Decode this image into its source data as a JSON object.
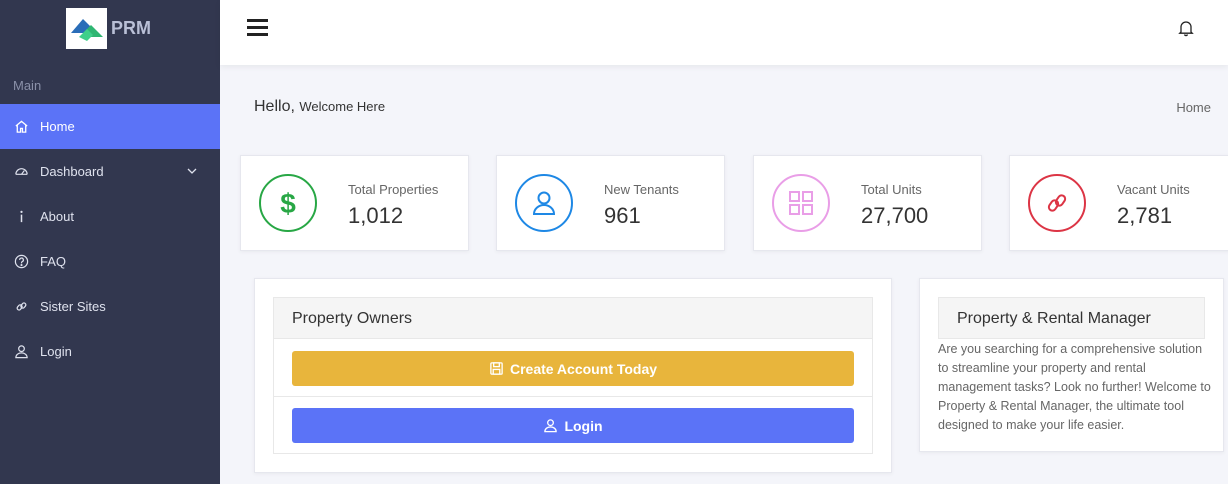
{
  "brand": {
    "name": "PRM"
  },
  "sidebar": {
    "section_label": "Main",
    "items": [
      {
        "label": "Home",
        "icon": "home-icon",
        "active": true
      },
      {
        "label": "Dashboard",
        "icon": "dashboard-icon",
        "has_submenu": true
      },
      {
        "label": "About",
        "icon": "info-icon"
      },
      {
        "label": "FAQ",
        "icon": "help-icon"
      },
      {
        "label": "Sister Sites",
        "icon": "link-icon"
      },
      {
        "label": "Login",
        "icon": "user-icon"
      }
    ]
  },
  "header": {
    "menu_icon": "hamburger-icon",
    "notification_icon": "bell-icon"
  },
  "welcome": {
    "hello": "Hello,",
    "subtitle": "Welcome Here"
  },
  "breadcrumb": {
    "current": "Home"
  },
  "stats": [
    {
      "label": "Total Properties",
      "value": "1,012",
      "icon": "dollar-icon",
      "color": "#28a745"
    },
    {
      "label": "New Tenants",
      "value": "961",
      "icon": "user-icon",
      "color": "#1e88e5"
    },
    {
      "label": "Total Units",
      "value": "27,700",
      "icon": "grid-icon",
      "color": "#e99ee7"
    },
    {
      "label": "Vacant Units",
      "value": "2,781",
      "icon": "link-icon",
      "color": "#dc3545"
    }
  ],
  "owners_panel": {
    "title": "Property Owners",
    "create_button": "Create Account Today",
    "login_button": "Login"
  },
  "info_card": {
    "title": "Property & Rental Manager",
    "text": "Are you searching for a comprehensive solution to streamline your property and rental management tasks? Look no further! Welcome to Property & Rental Manager, the ultimate tool designed to make your life easier."
  },
  "colors": {
    "sidebar_bg": "#32374f",
    "accent": "#5b73f7",
    "warning": "#e8b53c"
  }
}
